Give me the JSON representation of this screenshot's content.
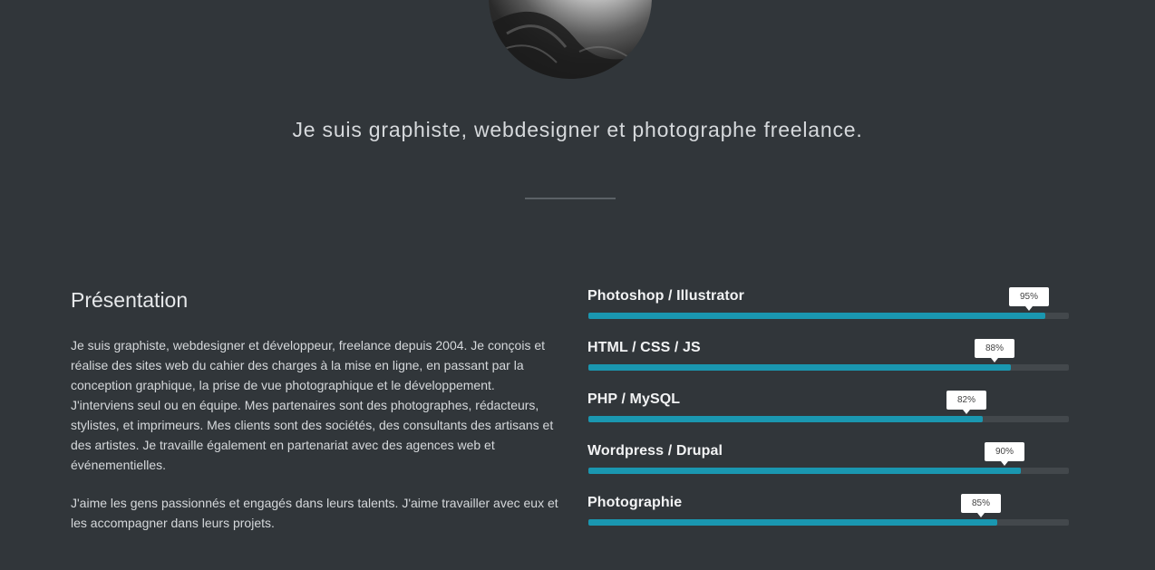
{
  "hero": {
    "tagline": "Je suis graphiste, webdesigner et photographe freelance."
  },
  "presentation": {
    "title": "Présentation",
    "paragraphs": [
      "Je suis graphiste, webdesigner et développeur, freelance depuis 2004. Je conçois et réalise des sites web du cahier des charges à la mise en ligne, en passant par la conception graphique, la prise de vue photographique et le développement. J'interviens seul ou en équipe. Mes partenaires sont des photographes, rédacteurs, stylistes, et imprimeurs. Mes clients sont des sociétés, des consultants des artisans et des artistes. Je travaille également en partenariat avec des agences web et événementielles.",
      "J'aime les gens passionnés et engagés dans leurs talents. J'aime travailler avec eux et les accompagner dans leurs projets."
    ]
  },
  "skills": [
    {
      "name": "Photoshop / Illustrator",
      "percent": 95,
      "label": "95%"
    },
    {
      "name": "HTML / CSS / JS",
      "percent": 88,
      "label": "88%"
    },
    {
      "name": "PHP / MySQL",
      "percent": 82,
      "label": "82%"
    },
    {
      "name": "Wordpress / Drupal",
      "percent": 90,
      "label": "90%"
    },
    {
      "name": "Photographie",
      "percent": 85,
      "label": "85%"
    }
  ],
  "colors": {
    "background": "#31363a",
    "bar_fill": "#1a97b0",
    "bar_track": "#43484c"
  }
}
